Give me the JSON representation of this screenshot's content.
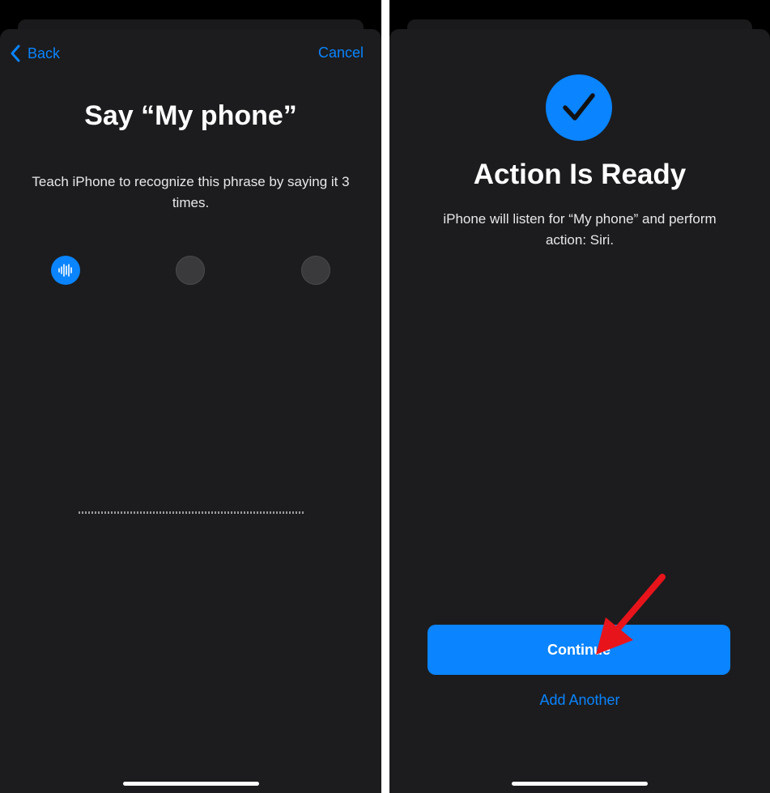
{
  "left_screen": {
    "nav": {
      "back_label": "Back",
      "cancel_label": "Cancel"
    },
    "title": "Say “My phone”",
    "subtitle": "Teach iPhone to recognize this phrase by saying it 3 times.",
    "steps": [
      {
        "state": "active",
        "icon": "waveform-icon"
      },
      {
        "state": "pending"
      },
      {
        "state": "pending"
      }
    ]
  },
  "right_screen": {
    "title": "Action Is Ready",
    "subtitle": "iPhone will listen for “My phone” and perform action: Siri.",
    "continue_label": "Continue",
    "add_another_label": "Add Another"
  },
  "colors": {
    "accent": "#0a84ff",
    "sheet_bg": "#1c1c1e",
    "annotation_arrow": "#e8141b"
  }
}
